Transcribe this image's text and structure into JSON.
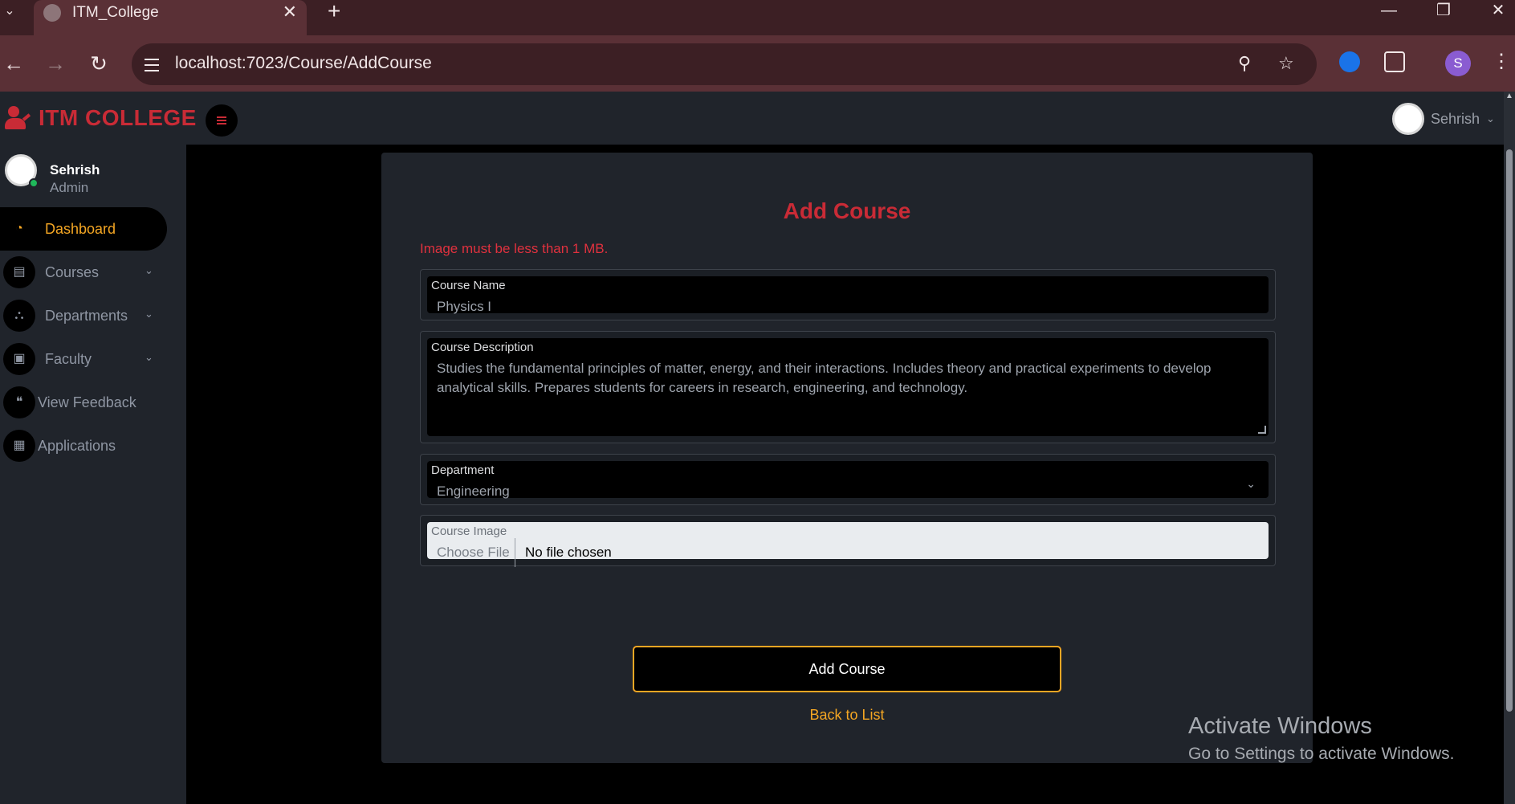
{
  "browser": {
    "tab_title": "ITM_College",
    "tab_close": "✕",
    "new_tab": "+",
    "url": "localhost:7023/Course/AddCourse",
    "profile_initial": "S"
  },
  "header": {
    "brand": "ITM COLLEGE",
    "user_name": "Sehrish"
  },
  "sidebar": {
    "user_name": "Sehrish",
    "user_role": "Admin",
    "items": [
      {
        "label": "Dashboard",
        "icon": "dashboard-icon",
        "active": true
      },
      {
        "label": "Courses",
        "icon": "book-icon",
        "has_submenu": true
      },
      {
        "label": "Departments",
        "icon": "sitemap-icon",
        "has_submenu": true
      },
      {
        "label": "Faculty",
        "icon": "teacher-icon",
        "has_submenu": true
      },
      {
        "label": "View Feedback",
        "icon": "comments-icon"
      },
      {
        "label": "Applications",
        "icon": "file-icon"
      }
    ]
  },
  "form": {
    "title": "Add Course",
    "error": "Image must be less than 1 MB.",
    "course_name": {
      "label": "Course Name",
      "value": "Physics I"
    },
    "course_description": {
      "label": "Course Description",
      "value": "Studies the fundamental principles of matter, energy, and their interactions. Includes theory and practical experiments to develop analytical skills. Prepares students for careers in research, engineering, and technology."
    },
    "department": {
      "label": "Department",
      "value": "Engineering"
    },
    "course_image": {
      "label": "Course Image",
      "button": "Choose File",
      "status": "No file chosen"
    },
    "submit": "Add Course",
    "back_link": "Back to List"
  },
  "watermark": {
    "title": "Activate Windows",
    "subtitle": "Go to Settings to activate Windows."
  },
  "colors": {
    "brand_red": "#c92b36",
    "accent_orange": "#f4a623",
    "sidebar_bg": "#20242b",
    "browser_bg": "#5a3036"
  }
}
